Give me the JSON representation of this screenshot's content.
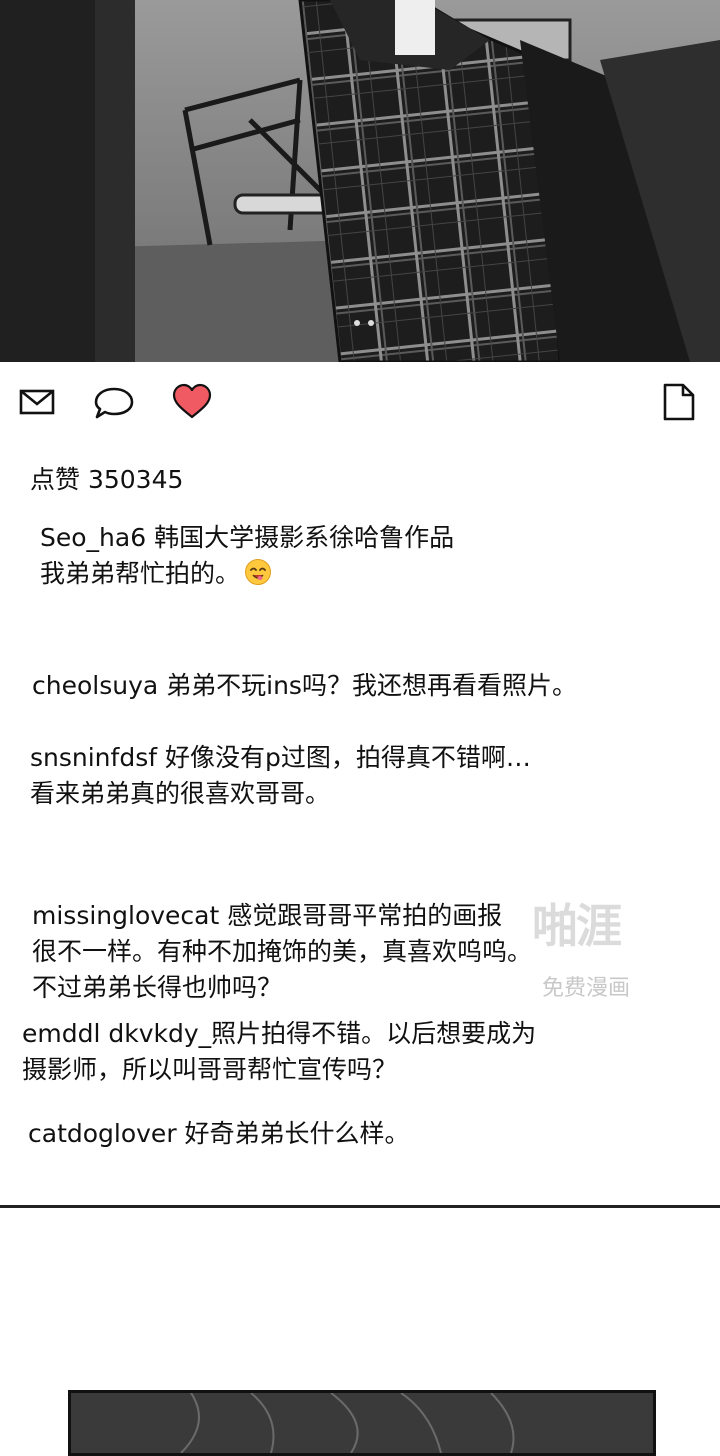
{
  "post": {
    "likes_label": "点赞 350345",
    "caption": {
      "line1": "Seo_ha6 韩国大学摄影系徐哈鲁作品",
      "line2": "我弟弟帮忙拍的。"
    }
  },
  "icons": {
    "share": "mail-icon",
    "comment": "speech-bubble-icon",
    "like": "heart-icon",
    "save": "document-icon",
    "heart_color": "#f05b63"
  },
  "comments": [
    {
      "lines": [
        "cheolsuya 弟弟不玩ins吗？我还想再看看照片。"
      ]
    },
    {
      "lines": [
        "snsninfdsf 好像没有p过图，拍得真不错啊…",
        "看来弟弟真的很喜欢哥哥。"
      ]
    },
    {
      "lines": [
        "missinglovecat 感觉跟哥哥平常拍的画报",
        "很不一样。有种不加掩饰的美，真喜欢呜呜。",
        "不过弟弟长得也帅吗？"
      ]
    },
    {
      "lines": [
        "emddl dkvkdy_照片拍得不错。以后想要成为",
        "摄影师，所以叫哥哥帮忙宣传吗？"
      ]
    },
    {
      "lines": [
        "catdoglover 好奇弟弟长什么样。"
      ]
    }
  ],
  "watermark": {
    "big": "啪涯",
    "small": "免费漫画"
  }
}
